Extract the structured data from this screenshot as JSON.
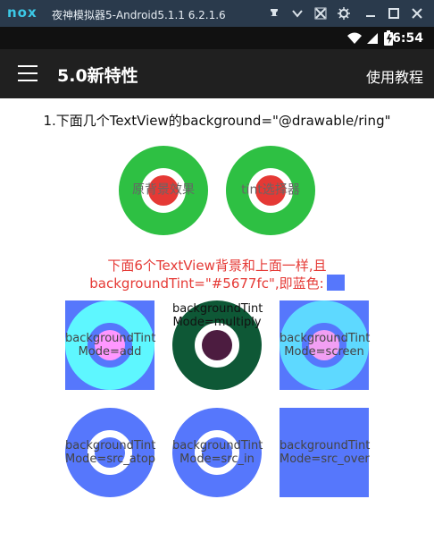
{
  "emulator": {
    "logo": "nox",
    "title": "夜神模拟器5-Android5.1.1 6.2.1.6",
    "icons": [
      "pin-icon",
      "chevron-down-icon",
      "settings-icon",
      "gear-icon",
      "minimize-icon",
      "maximize-icon",
      "close-icon"
    ]
  },
  "status_bar": {
    "time": "6:54",
    "icons": [
      "wifi-icon",
      "signal-icon",
      "battery-icon"
    ]
  },
  "appbar": {
    "title": "5.0新特性",
    "action": "使用教程",
    "menu_icon": "menu-icon"
  },
  "section1": {
    "heading": "1.下面几个TextView的background=\"@drawable/ring\"",
    "items": [
      {
        "label": "原背景效果"
      },
      {
        "label": "tint选择器"
      }
    ]
  },
  "section2": {
    "note_line1": "下面6个TextView背景和上面一样,且",
    "note_line2": "backgroundTint=\"#5677fc\",即蓝色:",
    "swatch_color": "#5677fc",
    "items": [
      {
        "line1": "backgroundTint",
        "line2": "Mode=add"
      },
      {
        "line1": "backgroundTint",
        "line2": "Mode=multiply"
      },
      {
        "line1": "backgroundTint",
        "line2": "Mode=screen"
      },
      {
        "line1": "backgroundTint",
        "line2": "Mode=src_atop"
      },
      {
        "line1": "backgroundTint",
        "line2": "Mode=src_in"
      },
      {
        "line1": "backgroundTint",
        "line2": "Mode=src_over"
      }
    ]
  },
  "colors": {
    "ring_green": "#2ec043",
    "center_red": "#e53935",
    "tint_blue": "#5677fc",
    "status_red": "#e53935"
  }
}
